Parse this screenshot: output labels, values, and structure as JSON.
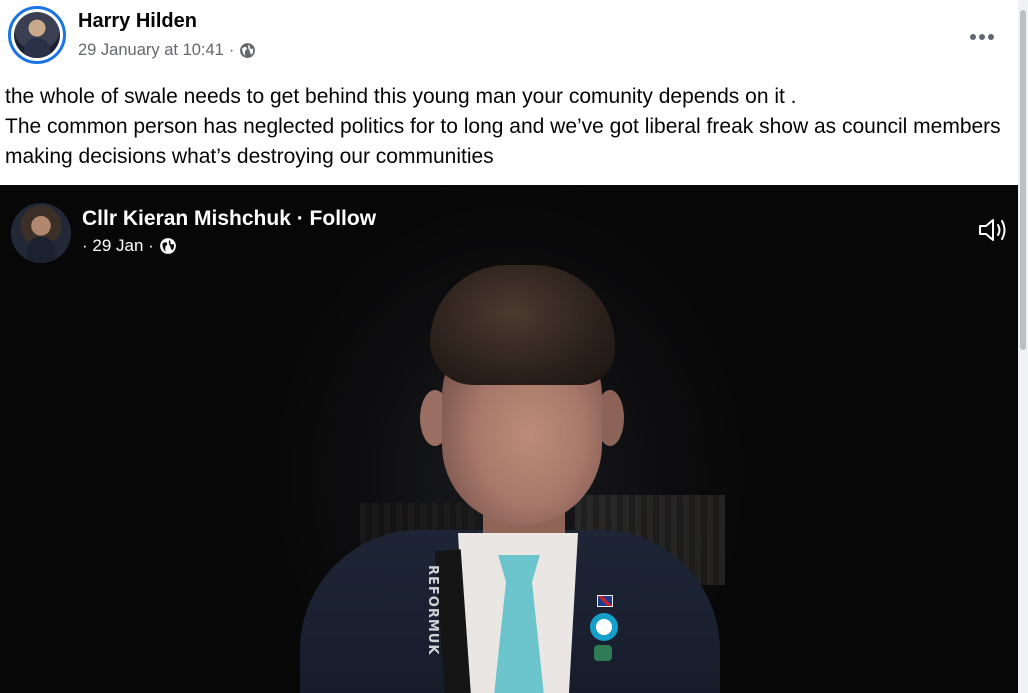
{
  "post": {
    "author": "Harry Hilden",
    "timestamp": "29 January at 10:41",
    "separator": "·",
    "privacy_icon": "globe-icon",
    "more_icon": "more-options-icon",
    "caption_line1": "the whole of swale needs to get behind this young man your comunity depends on it .",
    "caption_line2": "The common person has neglected politics for to long and we’ve got liberal freak show as council members making decisions what’s destroying our communities"
  },
  "video": {
    "author": "Cllr Kieran Mishchuk · Follow",
    "meta_prefix": "· 29 Jan ·",
    "privacy_icon": "globe-icon",
    "sound_icon": "speaker-icon",
    "lanyard_text": "REFORMUK"
  },
  "colors": {
    "accent": "#1b74e4",
    "meta_text": "#65676b",
    "video_bg": "#0b0b0b",
    "tie": "#6cc4cc"
  }
}
